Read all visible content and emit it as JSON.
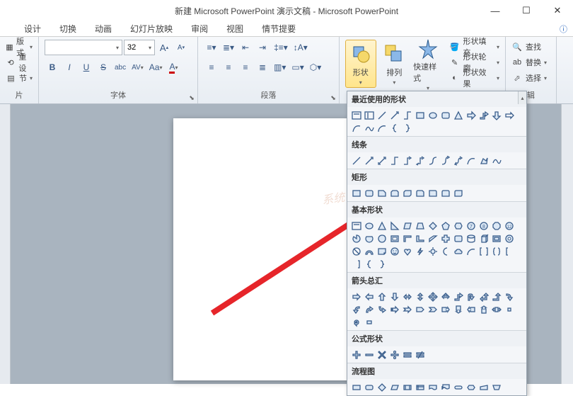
{
  "window": {
    "title": "新建 Microsoft PowerPoint 演示文稿 - Microsoft PowerPoint",
    "minimize": "—",
    "maximize": "☐",
    "close": "✕",
    "help": "ⓘ"
  },
  "tabs": {
    "items": [
      "设计",
      "切换",
      "动画",
      "幻灯片放映",
      "审阅",
      "视图",
      "情节提要"
    ]
  },
  "ribbon": {
    "slides_group": {
      "layout": "版式",
      "reset": "重设",
      "section": "节",
      "label": "片"
    },
    "font_group": {
      "label": "字体",
      "font_value": "",
      "size_value": "32",
      "grow": "A",
      "shrink": "A",
      "bold": "B",
      "italic": "I",
      "underline": "U",
      "strike": "S",
      "shadow": "abc",
      "spacing": "AV",
      "case": "Aa",
      "color": "A"
    },
    "paragraph_group": {
      "label": "段落"
    },
    "drawing_group": {
      "shapes": "形状",
      "arrange": "排列",
      "quickstyle": "快速样式",
      "fill": "形状填充",
      "outline": "形状轮廓",
      "effects": "形状效果"
    },
    "editing_group": {
      "label": "辑",
      "find": "查找",
      "replace": "替换",
      "select": "选择"
    }
  },
  "gallery": {
    "cat_recent": "最近使用的形状",
    "cat_lines": "线条",
    "cat_rect": "矩形",
    "cat_basic": "基本形状",
    "cat_arrows": "箭头总汇",
    "cat_equation": "公式形状",
    "cat_flow": "流程图"
  },
  "watermark": "系统"
}
